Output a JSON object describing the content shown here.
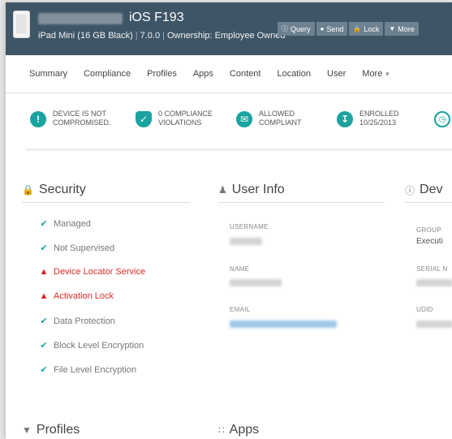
{
  "header": {
    "title": "iOS F193",
    "model": "iPad Mini (16 GB Black)",
    "os_version": "7.0.0",
    "ownership": "Ownership: Employee Owned",
    "actions": [
      {
        "label": "Query",
        "icon": "info-icon"
      },
      {
        "label": "Send",
        "icon": "chat-icon"
      },
      {
        "label": "Lock",
        "icon": "lock-icon"
      },
      {
        "label": "More",
        "icon": "caret-down-icon"
      }
    ]
  },
  "tabs": [
    "Summary",
    "Compliance",
    "Profiles",
    "Apps",
    "Content",
    "Location",
    "User",
    "More"
  ],
  "status": [
    {
      "line1": "DEVICE IS NOT",
      "line2": "COMPROMISED.",
      "icon": "exclamation-icon"
    },
    {
      "line1": "0 COMPLIANCE",
      "line2": "VIOLATIONS",
      "icon": "shield-icon"
    },
    {
      "line1": "ALLOWED",
      "line2": "COMPLIANT",
      "icon": "mail-icon"
    },
    {
      "line1": "ENROLLED",
      "line2": "10/25/2013",
      "icon": "enrolled-icon"
    }
  ],
  "security": {
    "title": "Security",
    "items": [
      {
        "label": "Managed",
        "state": "ok"
      },
      {
        "label": "Not Supervised",
        "state": "ok"
      },
      {
        "label": "Device Locator Service",
        "state": "warn"
      },
      {
        "label": "Activation Lock",
        "state": "warn"
      },
      {
        "label": "Data Protection",
        "state": "ok"
      },
      {
        "label": "Block Level Encryption",
        "state": "ok"
      },
      {
        "label": "File Level Encryption",
        "state": "ok"
      }
    ]
  },
  "user_info": {
    "title": "User Info",
    "username_label": "USERNAME",
    "name_label": "NAME",
    "email_label": "EMAIL"
  },
  "device_info": {
    "title": "Dev",
    "group_label": "GROUP",
    "group_value": "Executi",
    "serial_label": "SERIAL N",
    "udid_label": "UDID"
  },
  "bottom": {
    "profiles": "Profiles",
    "apps": "Apps"
  },
  "colors": {
    "header_bg": "#3e5566",
    "accent": "#1aa3a0",
    "warn": "#e02a2a"
  }
}
